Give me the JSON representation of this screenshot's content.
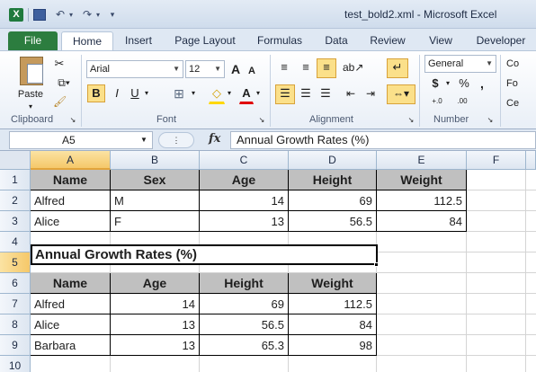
{
  "window": {
    "title": "test_bold2.xml - Microsoft Excel",
    "logo_letter": "X"
  },
  "ribbon_tabs": [
    "File",
    "Home",
    "Insert",
    "Page Layout",
    "Formulas",
    "Data",
    "Review",
    "View",
    "Developer"
  ],
  "ribbon": {
    "clipboard": {
      "label": "Clipboard",
      "paste_label": "Paste"
    },
    "font": {
      "label": "Font",
      "font_name": "Arial",
      "font_size": "12",
      "bold": "B",
      "italic": "I",
      "underline": "U",
      "grow": "A",
      "shrink": "A",
      "font_color_letter": "A"
    },
    "alignment": {
      "label": "Alignment"
    },
    "number": {
      "label": "Number",
      "format": "General",
      "currency": "$",
      "percent": "%",
      "comma": ",",
      "inc_decimal": "+.0",
      "dec_decimal": ".00"
    },
    "styles": {
      "items": [
        "Co",
        "Fo",
        "Ce"
      ]
    }
  },
  "formula_bar": {
    "name_box": "A5",
    "fx": "fx",
    "content": "Annual Growth Rates (%)"
  },
  "grid": {
    "columns": [
      "A",
      "B",
      "C",
      "D",
      "E",
      "F"
    ],
    "rows": [
      "1",
      "2",
      "3",
      "4",
      "5",
      "6",
      "7",
      "8",
      "9",
      "10"
    ],
    "table1": {
      "headers": [
        "Name",
        "Sex",
        "Age",
        "Height",
        "Weight"
      ],
      "rows": [
        [
          "Alfred",
          "M",
          "14",
          "69",
          "112.5"
        ],
        [
          "Alice",
          "F",
          "13",
          "56.5",
          "84"
        ]
      ]
    },
    "banner": "Annual Growth Rates (%)",
    "table2": {
      "headers": [
        "Name",
        "Age",
        "Height",
        "Weight"
      ],
      "rows": [
        [
          "Alfred",
          "14",
          "69",
          "112.5"
        ],
        [
          "Alice",
          "13",
          "56.5",
          "84"
        ],
        [
          "Barbara",
          "13",
          "65.3",
          "98"
        ]
      ]
    }
  }
}
